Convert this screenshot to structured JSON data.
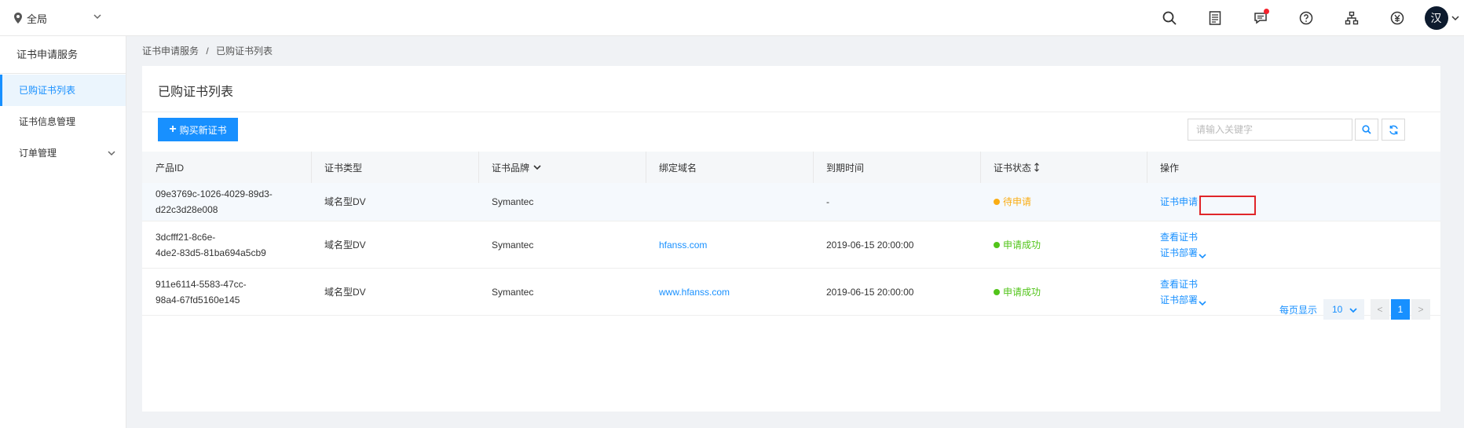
{
  "header": {
    "region_label": "全局",
    "avatar_text": "汉",
    "icons": [
      "search-icon",
      "document-icon",
      "message-icon",
      "help-icon",
      "org-icon",
      "currency-icon"
    ]
  },
  "sidebar": {
    "title": "证书申请服务",
    "items": [
      {
        "label": "已购证书列表",
        "active": true
      },
      {
        "label": "证书信息管理",
        "active": false
      },
      {
        "label": "订单管理",
        "active": false
      }
    ]
  },
  "breadcrumb": {
    "parent": "证书申请服务",
    "separator": "/",
    "current": "已购证书列表"
  },
  "main": {
    "title": "已购证书列表",
    "buy_button": "购买新证书",
    "search_placeholder": "请输入关键字"
  },
  "table": {
    "columns": [
      "产品ID",
      "证书类型",
      "证书品牌",
      "绑定域名",
      "到期时间",
      "证书状态",
      "操作"
    ],
    "rows": [
      {
        "id_line1": "09e3769c-1026-4029-89d3-",
        "id_line2": "d22c3d28e008",
        "type": "域名型DV",
        "brand": "Symantec",
        "domain": "",
        "expiry": "-",
        "status": "待申请",
        "ops": [
          "证书申请"
        ]
      },
      {
        "id_line1": "3dcfff21-8c6e-",
        "id_line2": "4de2-83d5-81ba694a5cb9",
        "type": "域名型DV",
        "brand": "Symantec",
        "domain": "hfanss.com",
        "expiry": "2019-06-15 20:00:00",
        "status": "申请成功",
        "ops": [
          "查看证书",
          "证书部署"
        ]
      },
      {
        "id_line1": "911e6114-5583-47cc-",
        "id_line2": "98a4-67fd5160e145",
        "type": "域名型DV",
        "brand": "Symantec",
        "domain": "www.hfanss.com",
        "expiry": "2019-06-15 20:00:00",
        "status": "申请成功",
        "ops": [
          "查看证书",
          "证书部署"
        ]
      }
    ]
  },
  "pagination": {
    "page_size_label": "每页显示",
    "page_size": "10",
    "prev": "<",
    "current_page": "1",
    "next": ">"
  },
  "colors": {
    "primary": "#1890ff",
    "pending": "#faad14",
    "success": "#52c41a",
    "highlight": "#e0262a"
  }
}
